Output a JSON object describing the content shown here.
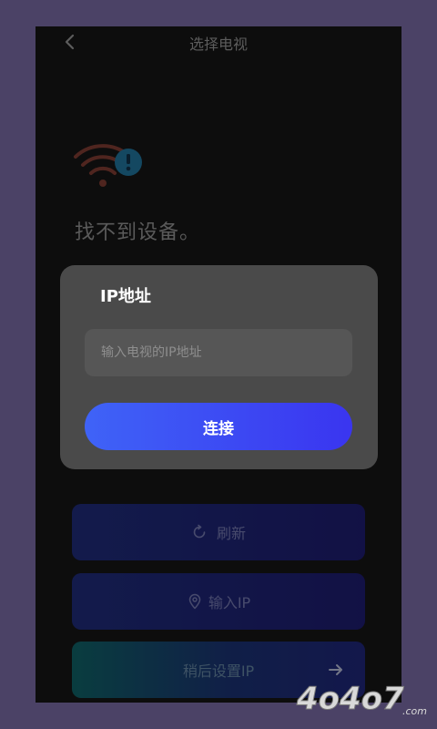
{
  "header": {
    "title": "选择电视",
    "back_icon": "chevron-left-icon"
  },
  "status": {
    "icon": "wifi-warning-icon",
    "message": "找不到设备。"
  },
  "dialog": {
    "title": "IP地址",
    "input_placeholder": "输入电视的IP地址",
    "input_value": "",
    "connect_label": "连接"
  },
  "actions": {
    "refresh_label": "刷新",
    "refresh_icon": "refresh-icon",
    "enter_ip_label": "输入IP",
    "enter_ip_icon": "location-pin-icon",
    "later_label": "稍后设置IP",
    "later_icon": "arrow-right-icon"
  },
  "watermark": {
    "text": "4o4o7",
    "suffix": ".com"
  },
  "colors": {
    "accent": "#3f63f7",
    "wifi": "#7a3a30",
    "warning_badge": "#1f6f96"
  }
}
